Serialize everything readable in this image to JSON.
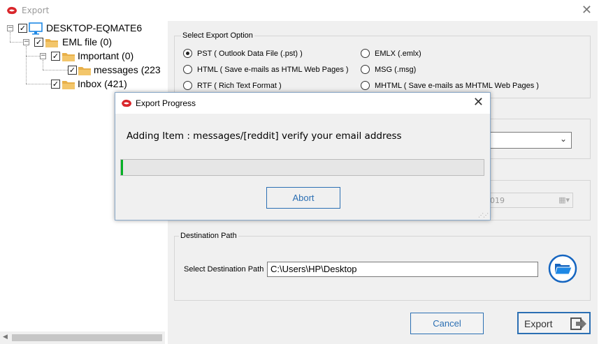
{
  "window": {
    "title": "Export"
  },
  "tree": {
    "root": {
      "label": "DESKTOP-EQMATE6"
    },
    "eml": {
      "label": "EML file (0)"
    },
    "important": {
      "label": "Important (0)"
    },
    "messages": {
      "label": "messages (223"
    },
    "inbox": {
      "label": "Inbox (421)"
    }
  },
  "export_options": {
    "title": "Select Export Option",
    "options": [
      {
        "label": "PST ( Outlook Data File (.pst) )",
        "selected": true
      },
      {
        "label": "EMLX (.emlx)",
        "selected": false
      },
      {
        "label": "HTML ( Save e-mails as HTML Web Pages )",
        "selected": false
      },
      {
        "label": "MSG  (.msg)",
        "selected": false
      },
      {
        "label": "RTF ( Rich Text Format )",
        "selected": false
      },
      {
        "label": "MHTML ( Save e-mails as MHTML Web Pages )",
        "selected": false
      }
    ]
  },
  "date_fragment": "019",
  "destination": {
    "title": "Destination Path",
    "label": "Select Destination Path",
    "value": "C:\\Users\\HP\\Desktop"
  },
  "buttons": {
    "cancel": "Cancel",
    "export": "Export"
  },
  "progress_dialog": {
    "title": "Export Progress",
    "message": "Adding Item : messages/[reddit] verify your email address",
    "progress_fraction": 0.005,
    "abort": "Abort"
  },
  "colors": {
    "accent": "#2b6fb3",
    "progress": "#06b025",
    "brand_red": "#d9262b"
  }
}
